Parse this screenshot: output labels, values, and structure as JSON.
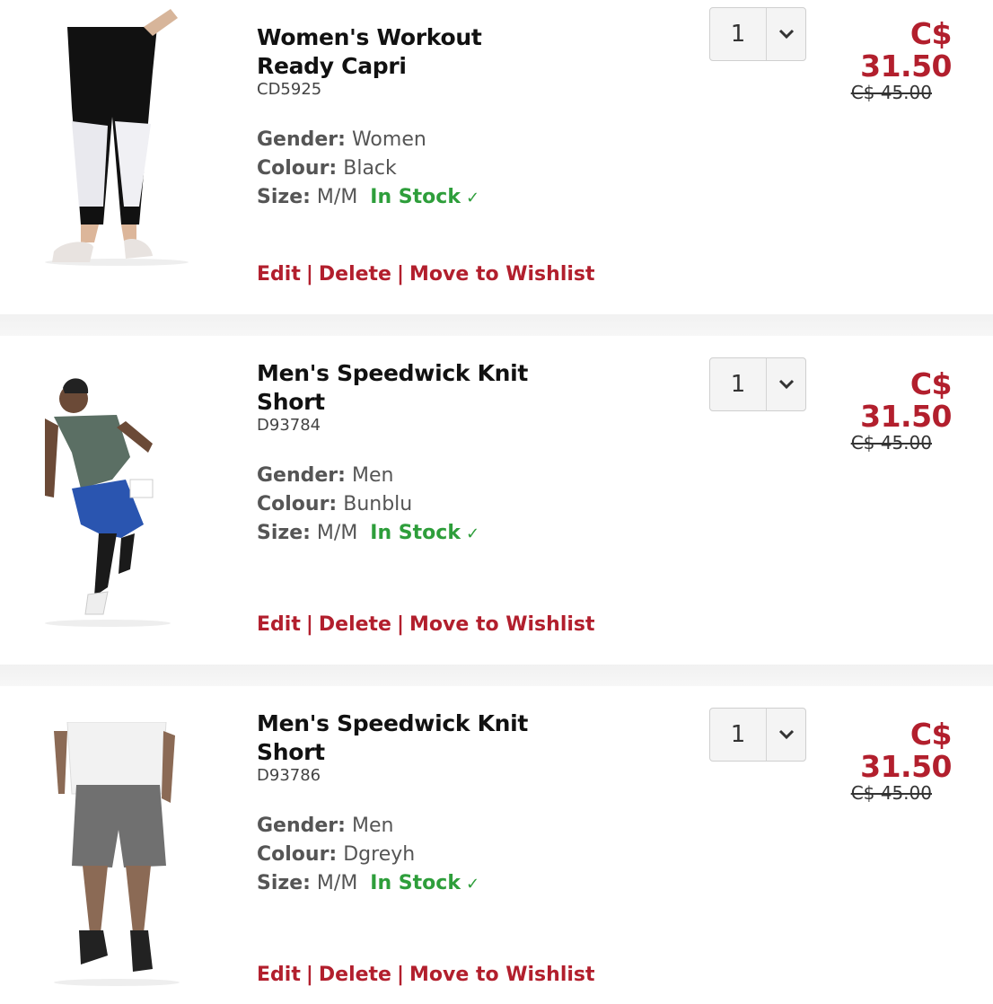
{
  "items": [
    {
      "name": "Women's Workout Ready Capri",
      "sku": "CD5925",
      "gender_label": "Gender:",
      "gender": "Women",
      "colour_label": "Colour:",
      "colour": "Black",
      "size_label": "Size:",
      "size": "M/M",
      "stock": "In Stock",
      "qty": "1",
      "price": "C$ 31.50",
      "was_price": "C$ 45.00",
      "edit": "Edit",
      "delete": "Delete",
      "wishlist": "Move to Wishlist"
    },
    {
      "name": "Men's Speedwick Knit Short",
      "sku": "D93784",
      "gender_label": "Gender:",
      "gender": "Men",
      "colour_label": "Colour:",
      "colour": "Bunblu",
      "size_label": "Size:",
      "size": "M/M",
      "stock": "In Stock",
      "qty": "1",
      "price": "C$ 31.50",
      "was_price": "C$ 45.00",
      "edit": "Edit",
      "delete": "Delete",
      "wishlist": "Move to Wishlist"
    },
    {
      "name": "Men's Speedwick Knit Short",
      "sku": "D93786",
      "gender_label": "Gender:",
      "gender": "Men",
      "colour_label": "Colour:",
      "colour": "Dgreyh",
      "size_label": "Size:",
      "size": "M/M",
      "stock": "In Stock",
      "qty": "1",
      "price": "C$ 31.50",
      "was_price": "C$ 45.00",
      "edit": "Edit",
      "delete": "Delete",
      "wishlist": "Move to Wishlist"
    }
  ],
  "colors": {
    "accent": "#b21f2d",
    "stock": "#2e9e3b"
  },
  "icons": {
    "qty_toggle": "chevron-down-icon",
    "stock": "check-icon"
  }
}
